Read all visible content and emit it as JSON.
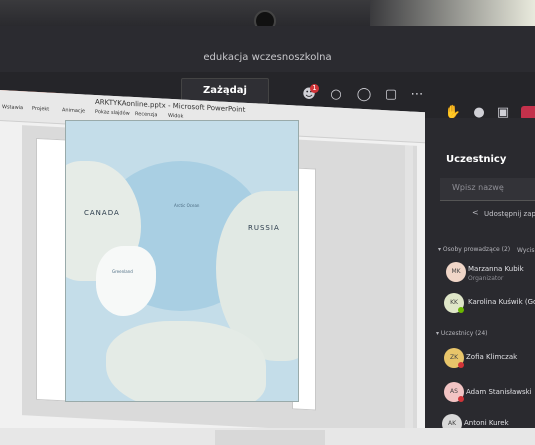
{
  "meeting": {
    "title": "edukacja wczesnoszkolna"
  },
  "toolbar": {
    "request_control_label": "Zażądaj kontroli",
    "participants_badge": "1",
    "icons": [
      "participants-icon",
      "chat-icon",
      "reactions-icon",
      "share-tray-icon",
      "more-icon",
      "raise-hand-icon",
      "mic-icon",
      "share-icon",
      "hang-up-icon"
    ]
  },
  "powerpoint": {
    "window_title": "ARKTYKAonline.pptx - Microsoft PowerPoint",
    "tabs": [
      "Wstawianie",
      "Projektowanie",
      "Animacje",
      "Pokaz slajdów",
      "Recenzja",
      "Widok"
    ],
    "tab_display": [
      "Wstawia",
      "Projekt",
      "Animacje",
      "Pokaz slajdów",
      "Recenzja",
      "Widok"
    ]
  },
  "map": {
    "labels": [
      "CANADA",
      "RUSSIA",
      "Greenland",
      "Arctic Ocean"
    ]
  },
  "panel": {
    "title": "Uczestnicy",
    "search_placeholder": "Wpisz nazwę",
    "share_link": "Udostępnij zap",
    "presenters_section": "Osoby prowadzące (2)",
    "presenters_action": "Wycis",
    "attendees_section": "Uczestnicy (24)",
    "presenters": [
      {
        "initials": "MK",
        "name": "Marzanna Kubik",
        "role": "Organizator"
      },
      {
        "initials": "KK",
        "name": "Karolina Kuświk (Gość)",
        "name_display": "Karolina Kuświk (Gos"
      }
    ],
    "attendees": [
      {
        "initials": "ZK",
        "name": "Zofia Klimczak"
      },
      {
        "initials": "AS",
        "name": "Adam Stanisławski"
      },
      {
        "initials": "AK",
        "name": "Antoni Kurek"
      }
    ]
  }
}
